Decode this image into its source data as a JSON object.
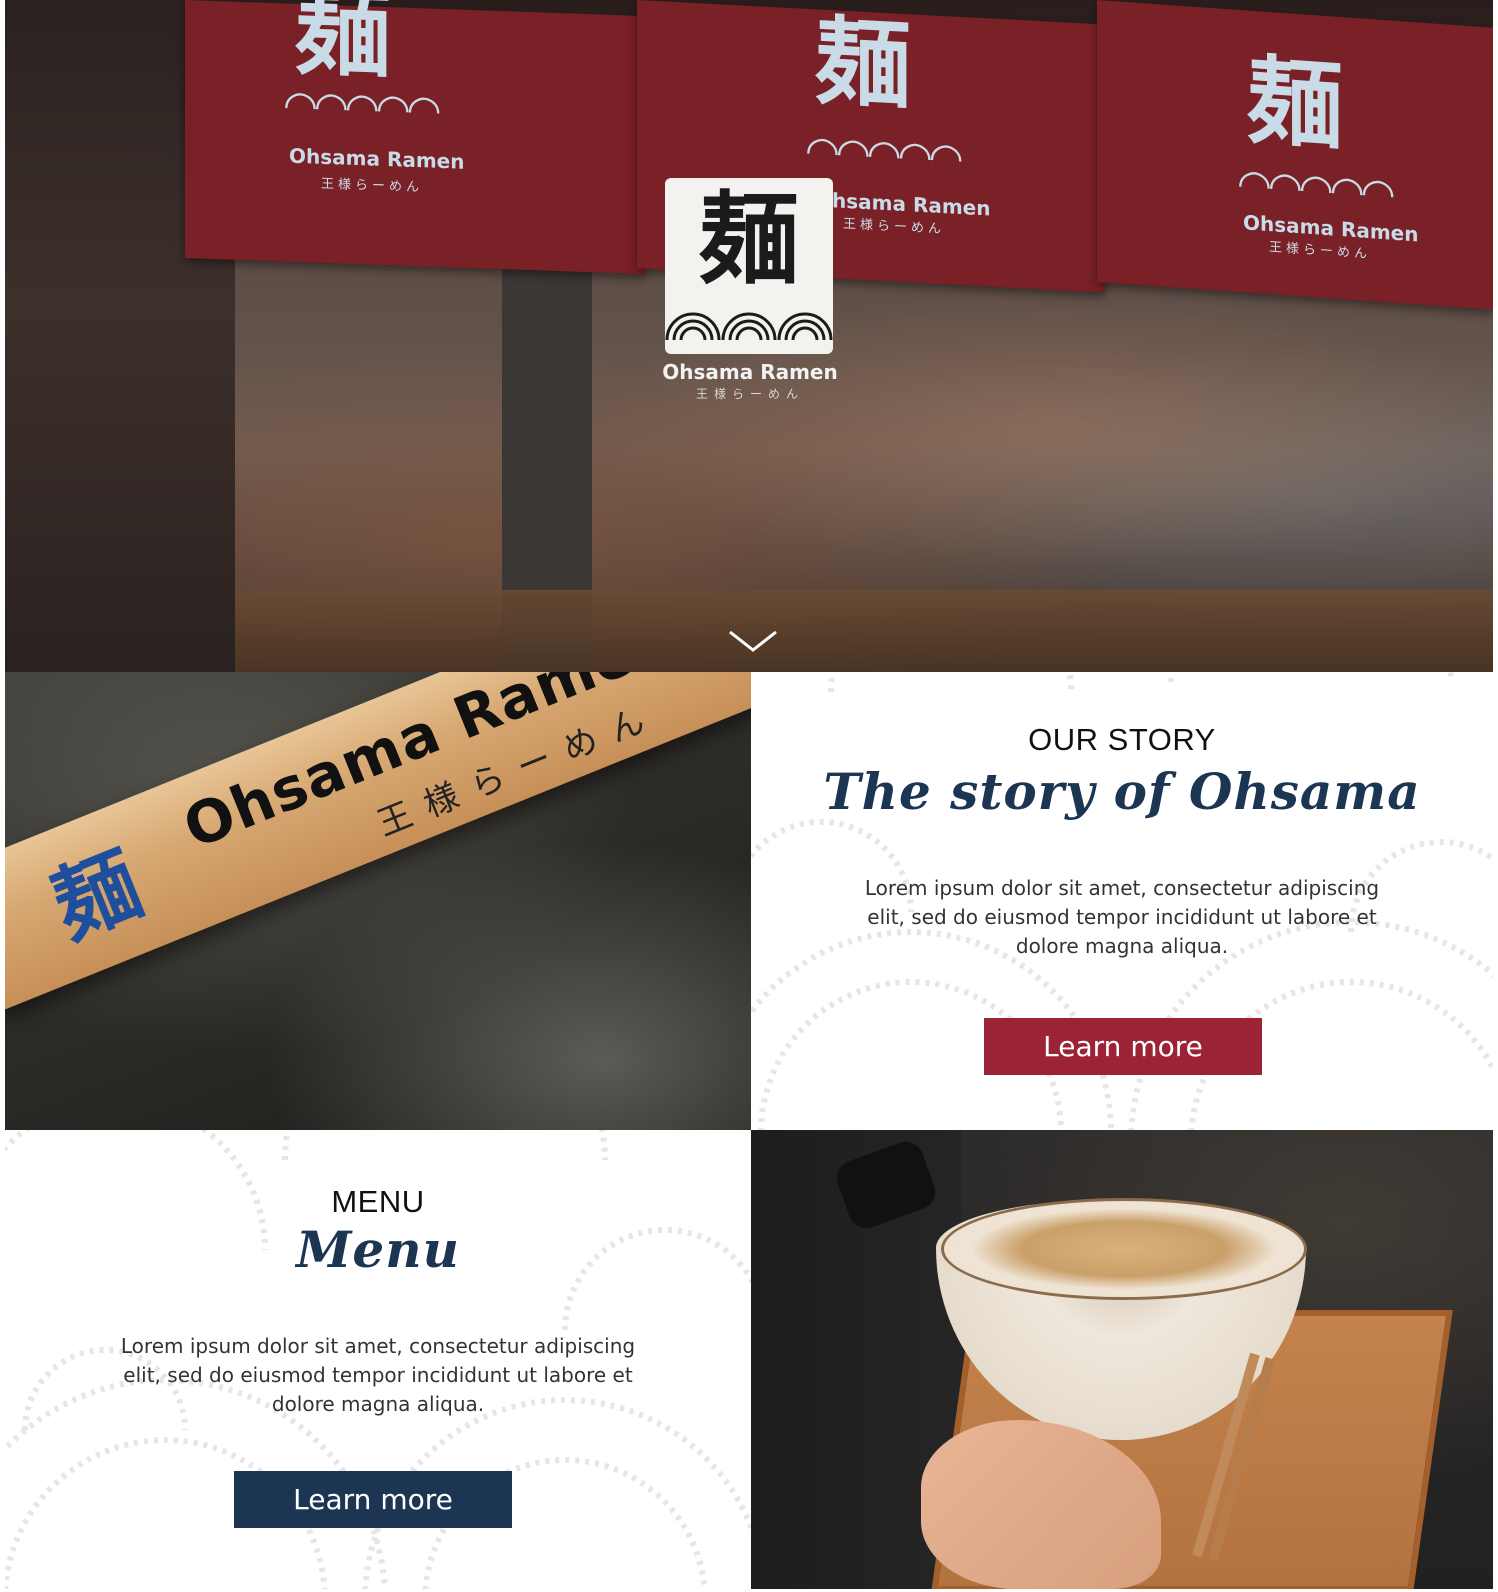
{
  "hero": {
    "noren": [
      {
        "glyph": "麺",
        "brand": "Ohsama Ramen",
        "sub": "王様らーめん"
      },
      {
        "glyph": "麺",
        "brand": "Ohsama Ramen",
        "sub": "王様らーめん"
      },
      {
        "glyph": "麺",
        "brand": "Ohsama Ramen",
        "sub": "王様らーめん"
      }
    ],
    "logo_glyph": "麺",
    "logo_name": "Ohsama Ramen",
    "logo_sub": "王様らーめん",
    "scroll_icon": "chevron-down-icon"
  },
  "sign_photo": {
    "glyph": "麺",
    "name": "Ohsama Ramen",
    "sub": "王様らーめん"
  },
  "story": {
    "kicker": "OUR STORY",
    "title": "The story of Ohsama",
    "body": "Lorem ipsum dolor sit amet, consectetur adipiscing elit, sed do eiusmod tempor incididunt ut labore et dolore magna aliqua.",
    "button_label": "Learn more",
    "button_color": "#9b2335"
  },
  "menu": {
    "kicker": "MENU",
    "title": "Menu",
    "body": "Lorem ipsum dolor sit amet, consectetur adipiscing elit, sed do eiusmod tempor incididunt ut labore et dolore magna aliqua.",
    "button_label": "Learn more",
    "button_color": "#1c3553"
  },
  "colors": {
    "noren_red": "#7a2127",
    "navy": "#1c3553",
    "crimson": "#9b2335"
  }
}
